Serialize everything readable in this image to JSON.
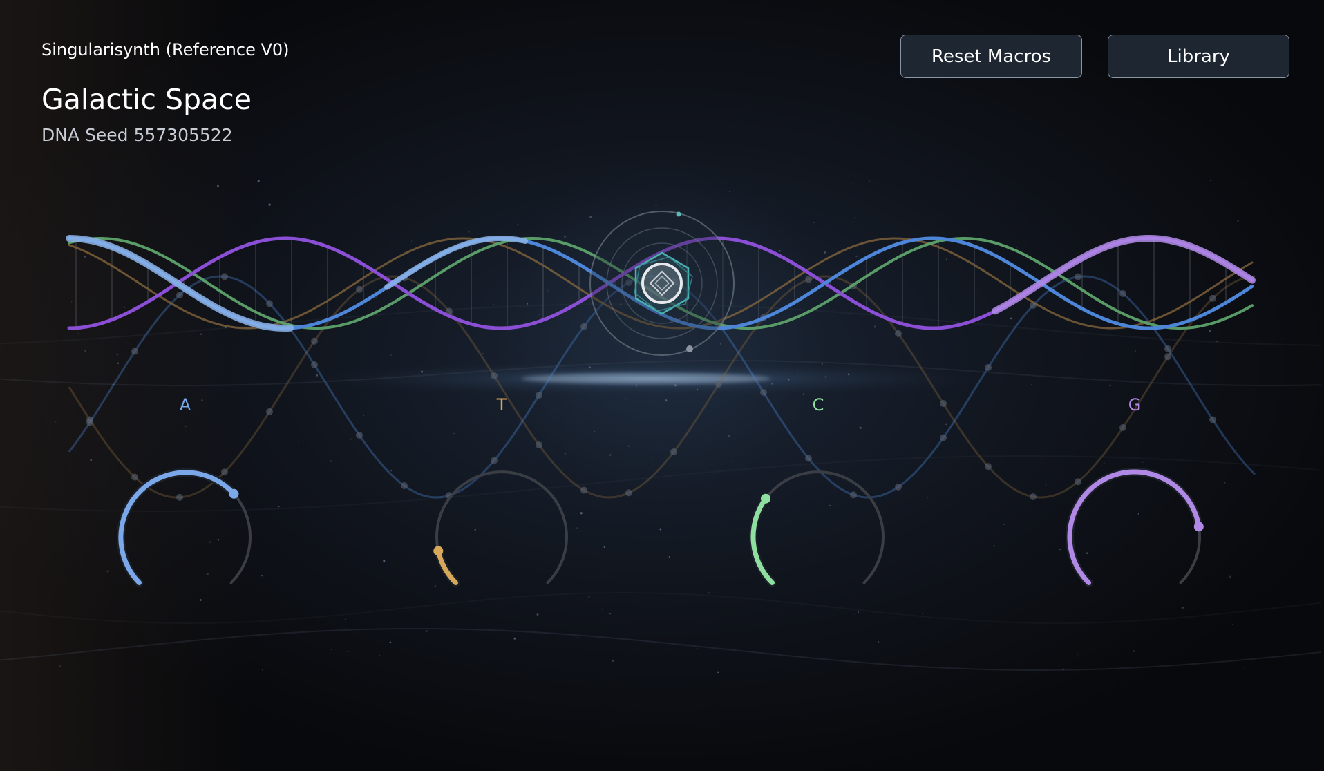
{
  "app": {
    "title": "Singularisynth (Reference V0)"
  },
  "preset": {
    "name": "Galactic Space",
    "seed_label": "DNA Seed",
    "seed_value": "557305522"
  },
  "toolbar": {
    "reset_label": "Reset Macros",
    "library_label": "Library"
  },
  "colors": {
    "background": "#0b0c10",
    "strand_blue": "#4d86d8",
    "strand_purple": "#8b4fd6",
    "strand_green": "#5ea36c",
    "strand_gold": "#8a6a3e",
    "knob_track": "#3a3d44",
    "core_teal": "#4ab0b0"
  },
  "macros": [
    {
      "letter": "A",
      "name": "macro-a",
      "color": "#7aa8e8",
      "value": 0.68
    },
    {
      "letter": "T",
      "name": "macro-t",
      "color": "#d7a85a",
      "value": 0.12
    },
    {
      "letter": "C",
      "name": "macro-c",
      "color": "#8fe0a0",
      "value": 0.3
    },
    {
      "letter": "G",
      "name": "macro-g",
      "color": "#b088e6",
      "value": 0.8
    }
  ],
  "icons": {
    "core": "helix-core-icon"
  }
}
